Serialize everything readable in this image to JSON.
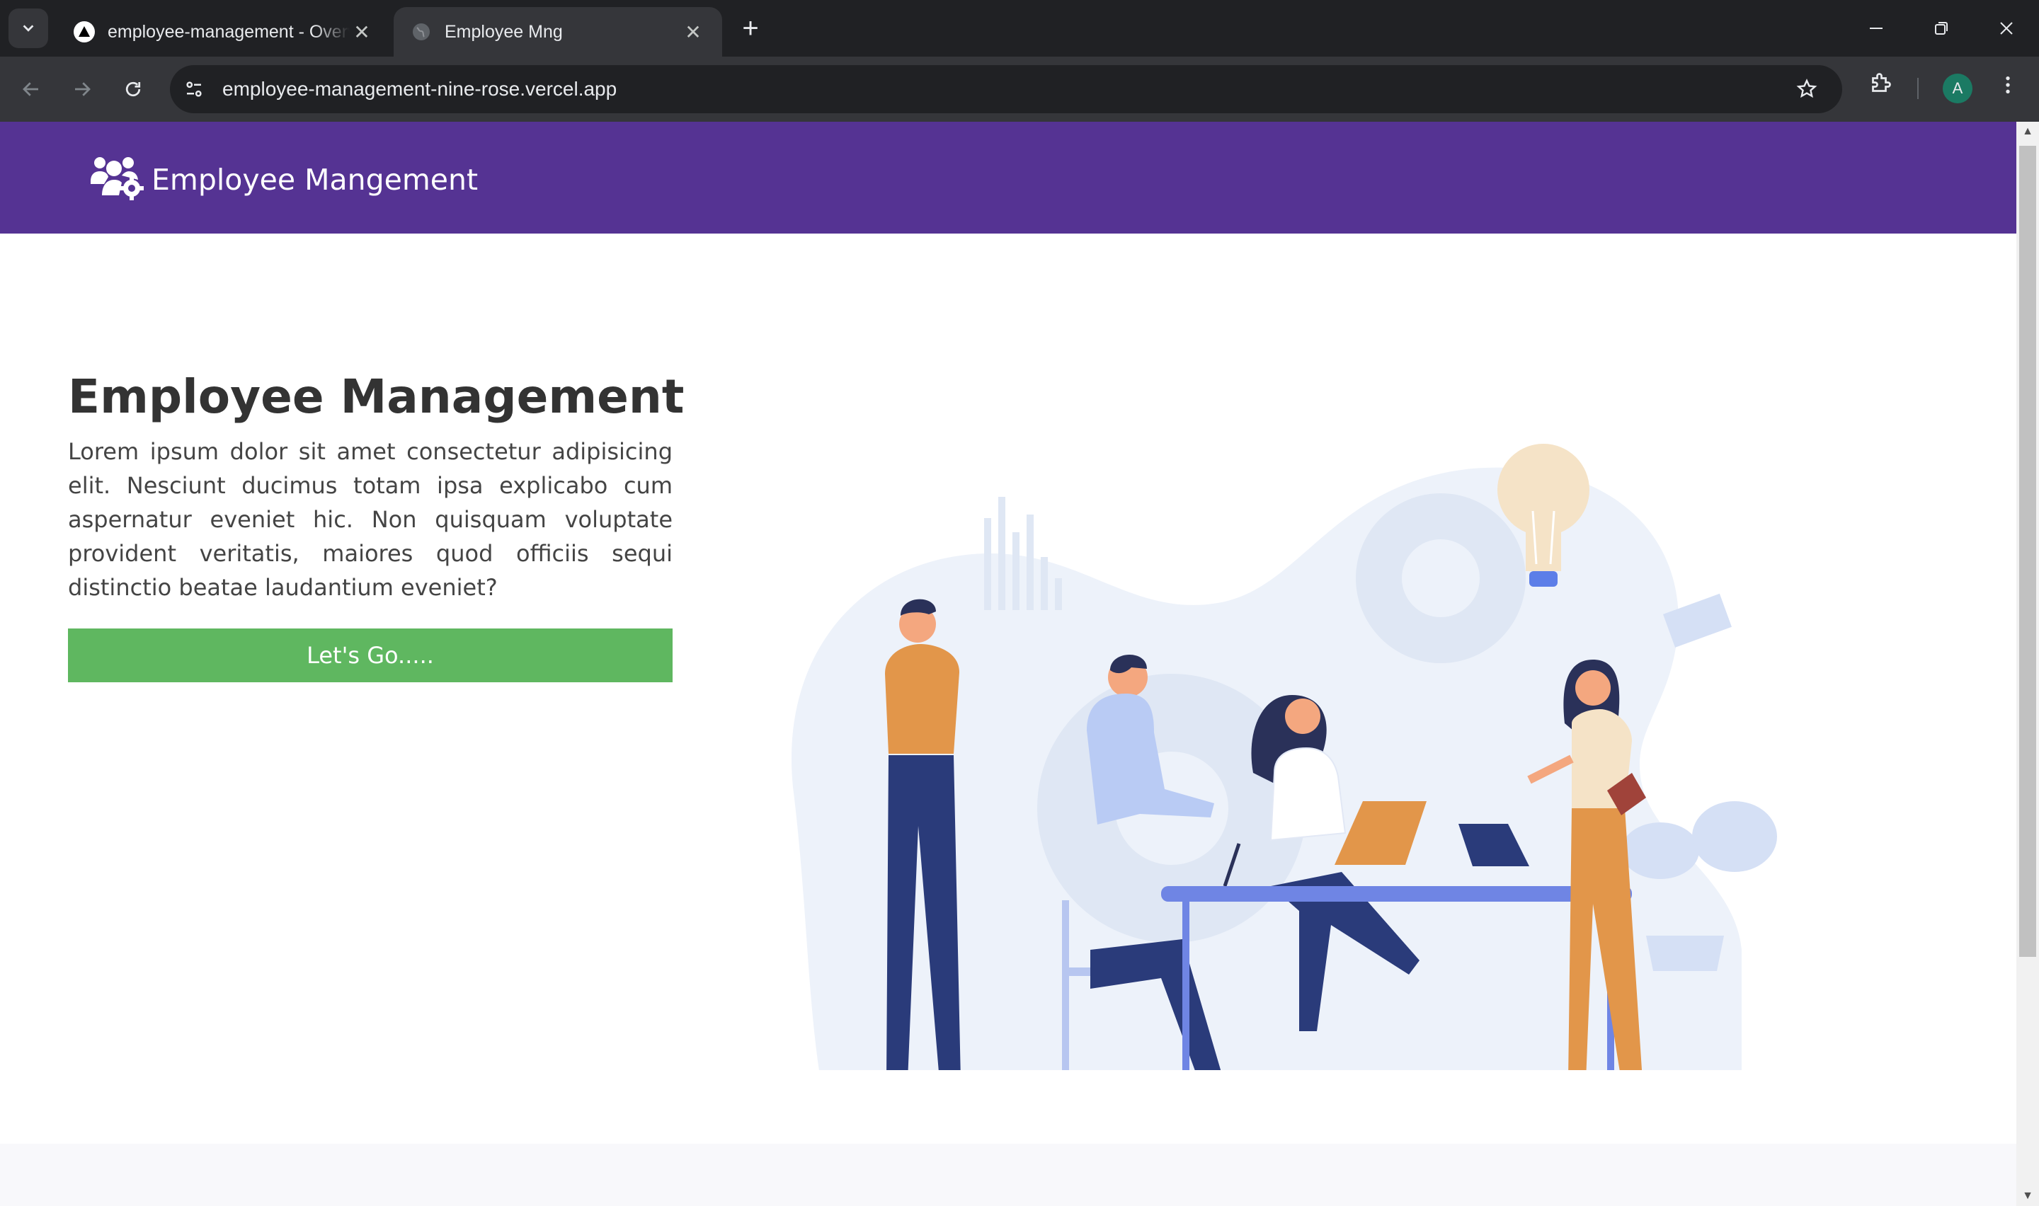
{
  "browser": {
    "tabs": [
      {
        "title": "employee-management - Overview",
        "active": false
      },
      {
        "title": "Employee Mng",
        "active": true
      }
    ],
    "url": "employee-management-nine-rose.vercel.app",
    "profile_initial": "A"
  },
  "navbar": {
    "brand": "Employee Mangement",
    "brand_icon": "users-cog-icon",
    "background": "#553393"
  },
  "hero": {
    "title": "Employee Management",
    "text": "Lorem ipsum dolor sit amet consectetur adipisicing elit. Nesciunt ducimus totam ipsa explicabo cum aspernatur eveniet hic. Non quisquam voluptate provident veritatis, maiores quod officiis sequi distinctio beatae laudantium eveniet?",
    "button_label": "Let's Go.....",
    "button_color": "#5fb760"
  }
}
